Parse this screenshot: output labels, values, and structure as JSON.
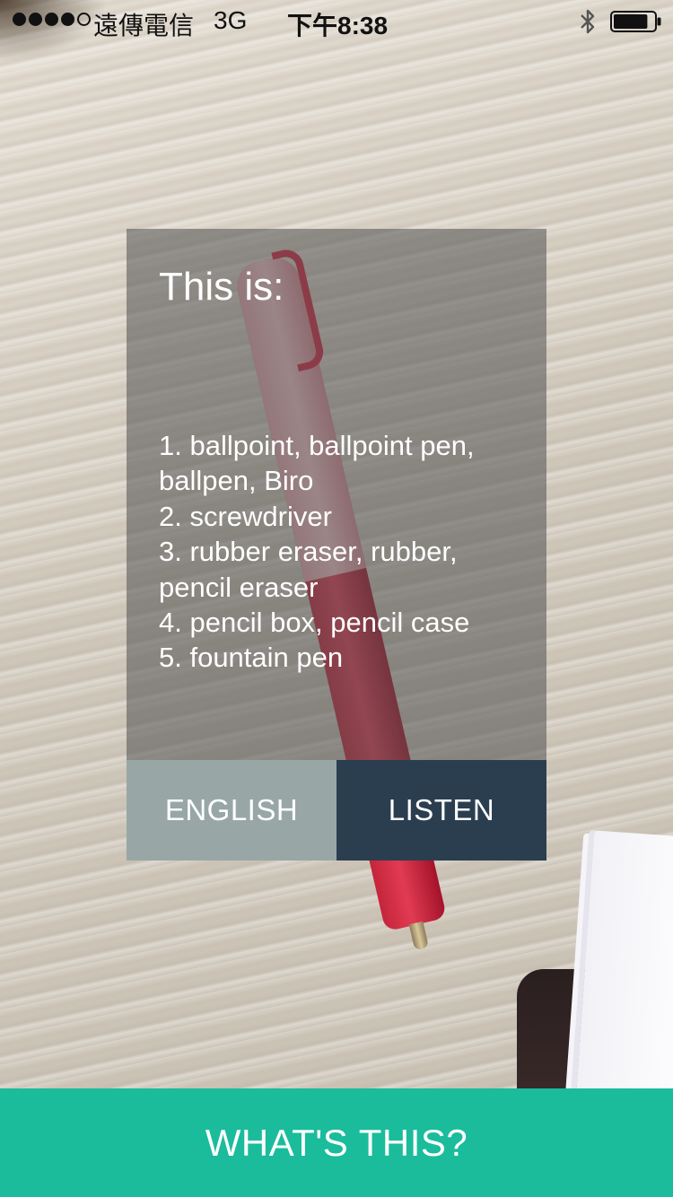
{
  "status_bar": {
    "signal_dots_filled": 4,
    "signal_dots_total": 5,
    "carrier": "遠傳電信",
    "network": "3G",
    "time": "下午8:38",
    "bluetooth_icon": "bluetooth-icon",
    "battery_icon": "battery-icon",
    "battery_level": 0.85
  },
  "card": {
    "title": "This is:",
    "results": [
      "1. ballpoint, ballpoint pen, ballpen, Biro",
      "2. screwdriver",
      "3. rubber eraser, rubber, pencil eraser",
      "4. pencil box, pencil case",
      "5. fountain pen"
    ],
    "english_label": "ENGLISH",
    "listen_label": "LISTEN"
  },
  "action": {
    "label": "WHAT'S THIS?"
  },
  "colors": {
    "accent": "#1abc9c",
    "english_button": "#98a7a6",
    "listen_button": "#2b3e50",
    "card_overlay": "rgba(80,80,80,0.55)"
  }
}
